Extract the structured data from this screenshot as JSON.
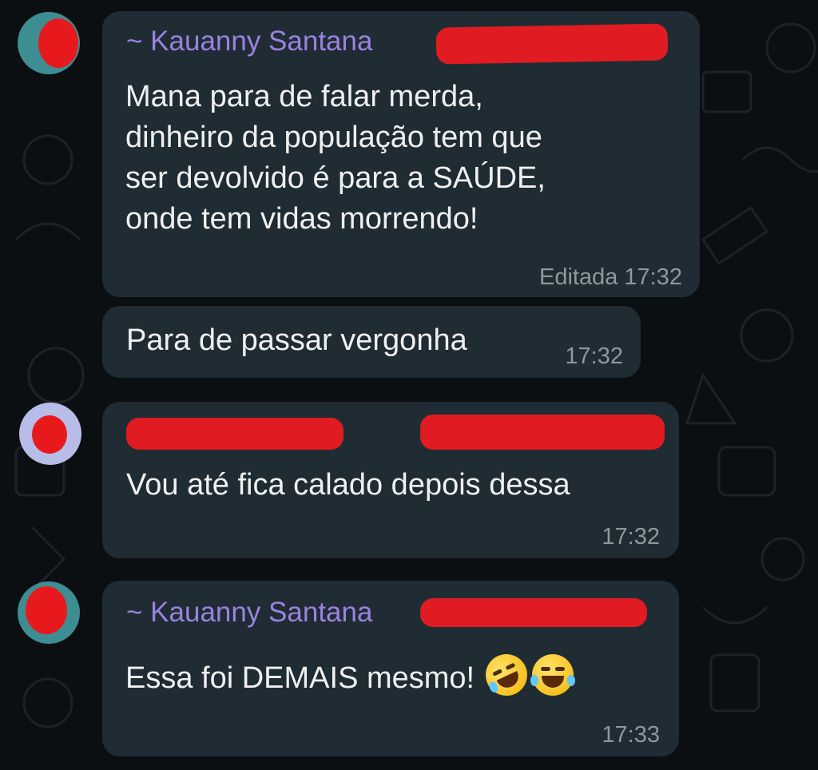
{
  "messages": [
    {
      "sender": "~ Kauanny Santana",
      "lines": [
        "Mana para de falar merda,",
        "dinheiro da população tem que",
        "ser devolvido é para a SAÚDE,",
        "onde tem vidas morrendo!"
      ],
      "edited_label": "Editada",
      "time": "17:32"
    },
    {
      "text": "Para de passar vergonha",
      "time": "17:32"
    },
    {
      "text": "Vou até fica calado depois dessa",
      "time": "17:32"
    },
    {
      "sender": "~ Kauanny Santana",
      "text": "Essa foi DEMAIS mesmo!",
      "emojis": [
        "rolling-on-floor-laughing-emoji",
        "tears-of-joy-emoji"
      ],
      "time": "17:33"
    }
  ],
  "colors": {
    "background": "#0b0f12",
    "bubble": "#1f2c33",
    "sender": "#9a82e0",
    "timestamp": "#8f989e",
    "redaction": "#e11b22"
  }
}
